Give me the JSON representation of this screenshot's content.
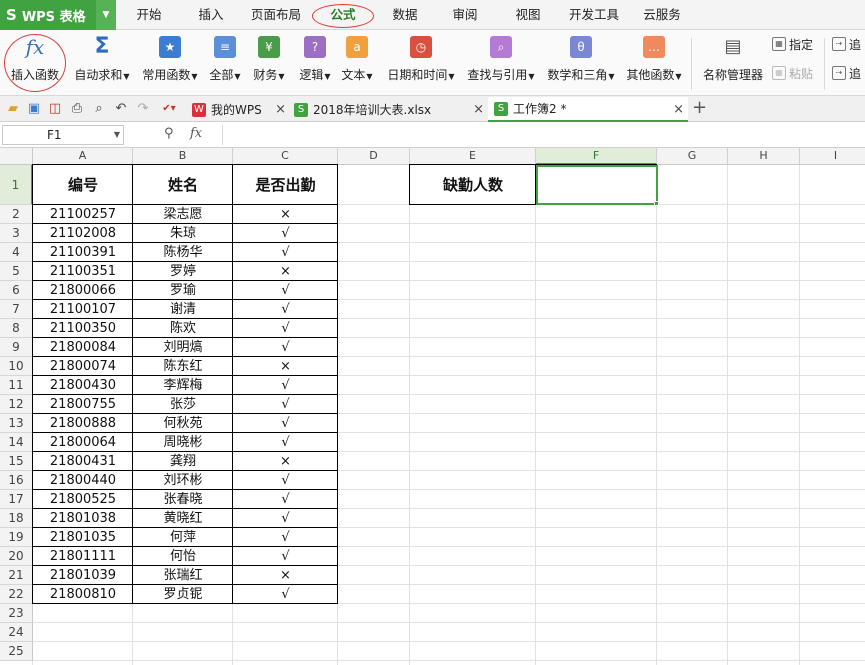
{
  "app": {
    "logo": "S",
    "name": "WPS 表格"
  },
  "menu": [
    {
      "label": "开始"
    },
    {
      "label": "插入"
    },
    {
      "label": "页面布局"
    },
    {
      "label": "公式"
    },
    {
      "label": "数据"
    },
    {
      "label": "审阅"
    },
    {
      "label": "视图"
    },
    {
      "label": "开发工具"
    },
    {
      "label": "云服务"
    }
  ],
  "ribbon": {
    "buttons": [
      {
        "label": "插入函数",
        "icon": "fx"
      },
      {
        "label": "自动求和",
        "icon": "Σ"
      },
      {
        "label": "常用函数",
        "icon": "★"
      },
      {
        "label": "全部",
        "icon": "≡"
      },
      {
        "label": "财务",
        "icon": "¥"
      },
      {
        "label": "逻辑",
        "icon": "?"
      },
      {
        "label": "文本",
        "icon": "a"
      },
      {
        "label": "日期和时间",
        "icon": "◷"
      },
      {
        "label": "查找与引用",
        "icon": "⌕"
      },
      {
        "label": "数学和三角",
        "icon": "θ"
      },
      {
        "label": "其他函数",
        "icon": "…"
      },
      {
        "label": "名称管理器",
        "icon": "▤"
      }
    ],
    "small": [
      {
        "label": "指定"
      },
      {
        "label": "粘贴"
      },
      {
        "label": "追"
      },
      {
        "label": "追"
      }
    ]
  },
  "doc_tabs": [
    {
      "label": "我的WPS"
    },
    {
      "label": "2018年培训大表.xlsx"
    },
    {
      "label": "工作簿2 *"
    }
  ],
  "formula_bar": {
    "cell_ref": "F1",
    "value": ""
  },
  "columns": [
    "A",
    "B",
    "C",
    "D",
    "E",
    "F",
    "G",
    "H",
    "I"
  ],
  "rows": [
    "1",
    "2",
    "3",
    "4",
    "5",
    "6",
    "7",
    "8",
    "9",
    "10",
    "11",
    "12",
    "13",
    "14",
    "15",
    "16",
    "17",
    "18",
    "19",
    "20",
    "21",
    "22",
    "23",
    "24",
    "25"
  ],
  "table": {
    "headers": [
      "编号",
      "姓名",
      "是否出勤"
    ],
    "records": [
      [
        "21100257",
        "梁志愿",
        "×"
      ],
      [
        "21102008",
        "朱琼",
        "√"
      ],
      [
        "21100391",
        "陈杨华",
        "√"
      ],
      [
        "21100351",
        "罗婷",
        "×"
      ],
      [
        "21800066",
        "罗瑜",
        "√"
      ],
      [
        "21100107",
        "谢清",
        "√"
      ],
      [
        "21100350",
        "陈欢",
        "√"
      ],
      [
        "21800084",
        "刘明熇",
        "√"
      ],
      [
        "21800074",
        "陈东红",
        "×"
      ],
      [
        "21800430",
        "李辉梅",
        "√"
      ],
      [
        "21800755",
        "张莎",
        "√"
      ],
      [
        "21800888",
        "何秋苑",
        "√"
      ],
      [
        "21800064",
        "周晓彬",
        "√"
      ],
      [
        "21800431",
        "龚翔",
        "×"
      ],
      [
        "21800440",
        "刘环彬",
        "√"
      ],
      [
        "21800525",
        "张春晓",
        "√"
      ],
      [
        "21801038",
        "黄晓红",
        "√"
      ],
      [
        "21801035",
        "何萍",
        "√"
      ],
      [
        "21801111",
        "何怡",
        "√"
      ],
      [
        "21801039",
        "张瑞红",
        "×"
      ],
      [
        "21800810",
        "罗贞铌",
        "√"
      ]
    ]
  },
  "absence": {
    "label": "缺勤人数",
    "value": ""
  },
  "colors": {
    "accent": "#41a241",
    "annotation": "#e03a3a"
  }
}
